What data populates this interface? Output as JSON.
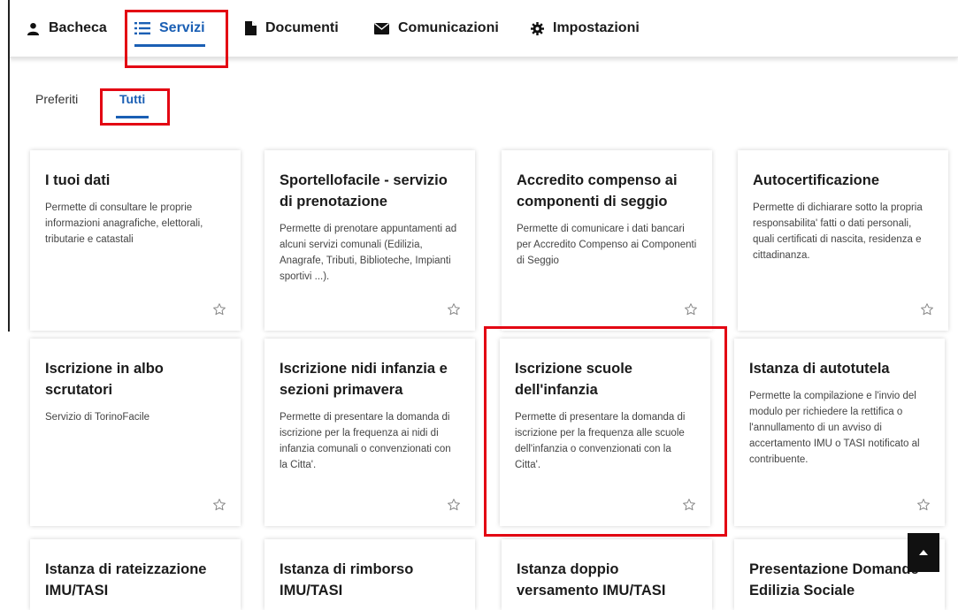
{
  "nav": {
    "bacheca": "Bacheca",
    "servizi": "Servizi",
    "documenti": "Documenti",
    "comunicazioni": "Comunicazioni",
    "impostazioni": "Impostazioni"
  },
  "subtabs": {
    "preferiti": "Preferiti",
    "tutti": "Tutti"
  },
  "cards": [
    {
      "title": "I tuoi dati",
      "desc": "Permette di consultare le proprie informazioni anagrafiche, elettorali, tributarie e catastali"
    },
    {
      "title": "Sportellofacile - servizio di prenotazione",
      "desc": "Permette di prenotare appuntamenti ad alcuni servizi comunali (Edilizia, Anagrafe, Tributi, Biblioteche, Impianti sportivi ...)."
    },
    {
      "title": "Accredito compenso ai componenti di seggio",
      "desc": "Permette di comunicare i dati bancari per Accredito Compenso ai Componenti di Seggio"
    },
    {
      "title": "Autocertificazione",
      "desc": "Permette di dichiarare sotto la propria responsabilita' fatti o dati personali, quali certificati di nascita, residenza e cittadinanza."
    },
    {
      "title": "Iscrizione in albo scrutatori",
      "desc": "Servizio di TorinoFacile"
    },
    {
      "title": "Iscrizione nidi infanzia e sezioni primavera",
      "desc": "Permette di presentare la domanda di iscrizione per la frequenza ai nidi di infanzia comunali o convenzionati con la Citta'."
    },
    {
      "title": "Iscrizione scuole dell'infanzia",
      "desc": "Permette di presentare la domanda di iscrizione per la frequenza alle scuole dell'infanzia o convenzionati con la Citta'."
    },
    {
      "title": "Istanza di autotutela",
      "desc": "Permette la compilazione e l'invio del modulo per richiedere la rettifica o l'annullamento di un avviso di accertamento IMU o TASI notificato al contribuente."
    },
    {
      "title": "Istanza di rateizzazione IMU/TASI",
      "desc": ""
    },
    {
      "title": "Istanza di rimborso IMU/TASI",
      "desc": ""
    },
    {
      "title": "Istanza doppio versamento IMU/TASI",
      "desc": ""
    },
    {
      "title": "Presentazione Domande Edilizia Sociale",
      "desc": ""
    }
  ],
  "colors": {
    "accent": "#1a5fb4",
    "highlight": "#e30613"
  }
}
